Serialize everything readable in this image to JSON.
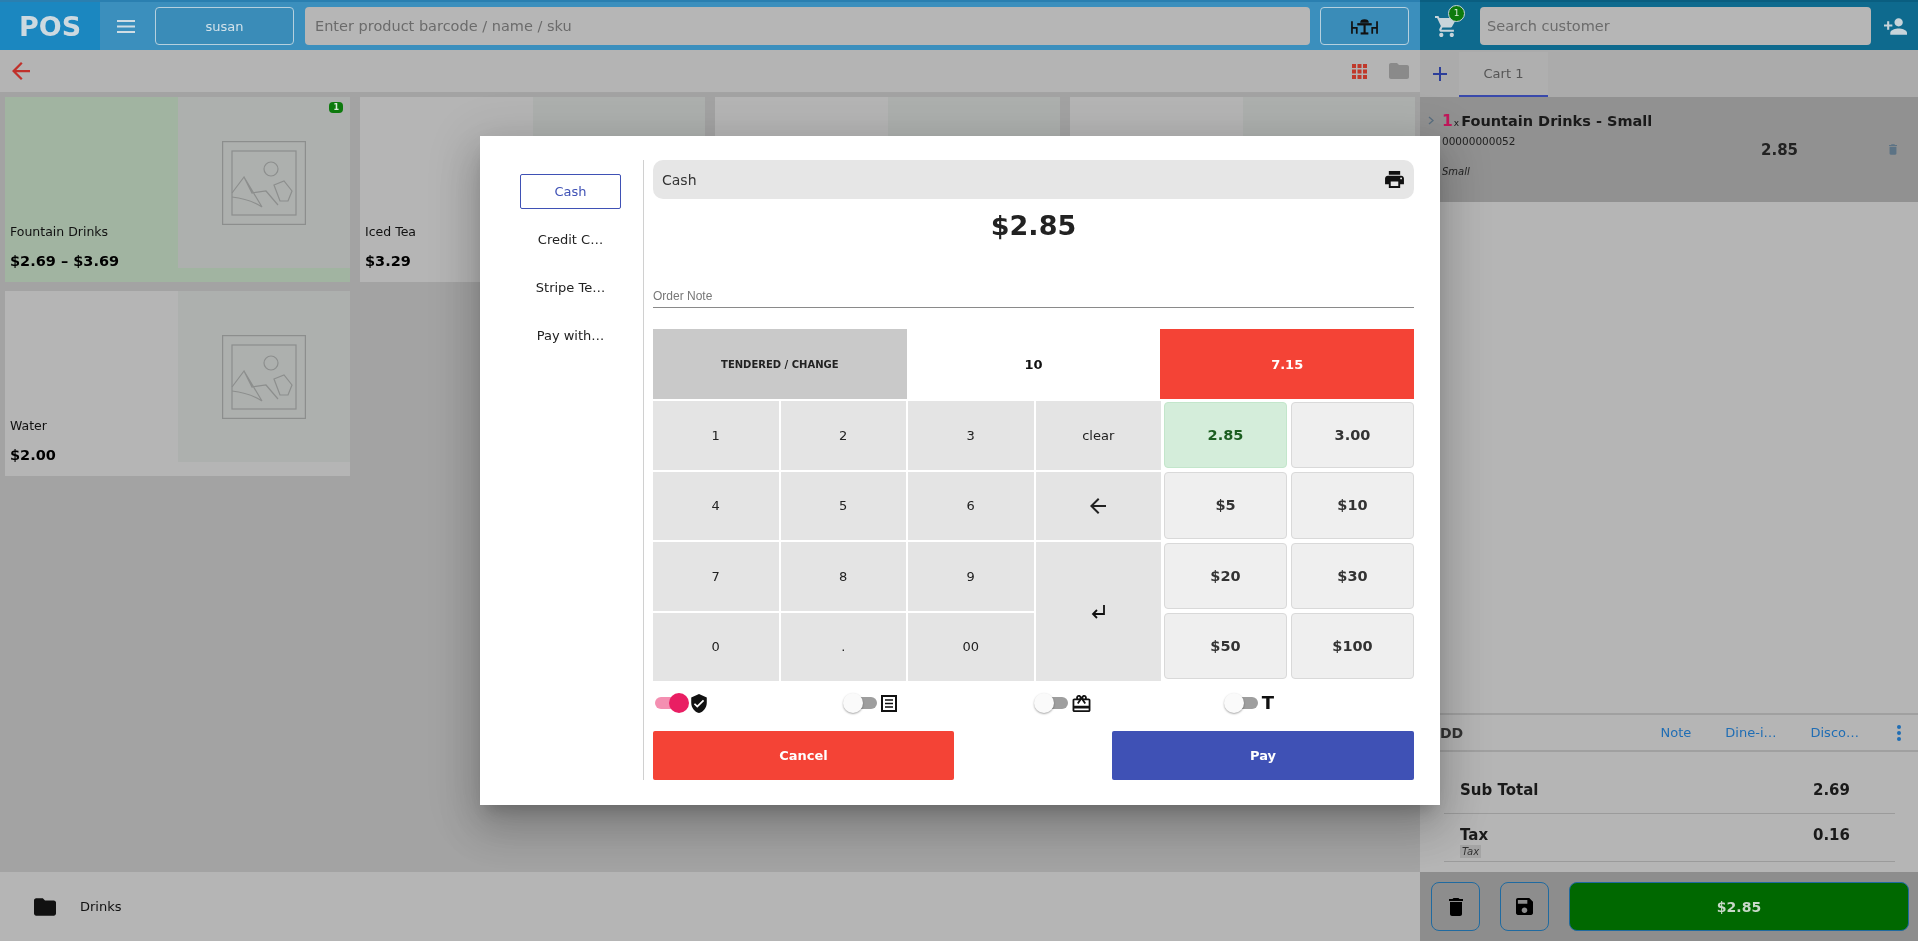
{
  "top_bar": {
    "logo": "POS",
    "user_button": "susan",
    "product_search": {
      "placeholder": "Enter product barcode / name / sku"
    },
    "cart_count": "1",
    "customer_search": {
      "placeholder": "Search customer"
    }
  },
  "view_modes": [
    {
      "kind": "grid",
      "selected": true
    },
    {
      "kind": "folder",
      "selected": false
    }
  ],
  "products": [
    {
      "kind": "full",
      "name": "Fountain Drinks",
      "price": "$2.69 – $3.69",
      "badge": "1",
      "selected": true
    },
    {
      "kind": "text",
      "name": "Iced Tea",
      "price": "$3.29",
      "selected": false
    },
    {
      "kind": "blank",
      "selected": false
    },
    {
      "kind": "blank",
      "selected": false
    },
    {
      "kind": "full",
      "name": "Water",
      "price": "$2.00",
      "selected": false
    }
  ],
  "categories": [
    {
      "name": "Drinks"
    }
  ],
  "cart": {
    "tabs": [
      {
        "label": "Cart 1",
        "selected": true
      }
    ],
    "items": [
      {
        "quantity": "1",
        "times": "x",
        "name": "Fountain Drinks - Small",
        "sku": "00000000052",
        "price": "2.85",
        "variant": "Small",
        "selected": true
      }
    ],
    "add_label": "DD",
    "links": [
      "Note",
      "Dine-i…",
      "Disco…"
    ],
    "totals": [
      {
        "label": "Sub Total",
        "value": "2.69"
      },
      {
        "label": "Tax",
        "value": "0.16",
        "note": "Tax"
      }
    ],
    "checkout_button": "$2.85"
  },
  "payment_dialog": {
    "methods": [
      {
        "label": "Cash",
        "selected": true
      },
      {
        "label": "Credit C…",
        "selected": false
      },
      {
        "label": "Stripe Te…",
        "selected": false
      },
      {
        "label": "Pay with…",
        "selected": false
      }
    ],
    "method_title": "Cash",
    "amount": "$2.85",
    "order_note": {
      "placeholder": "Order Note"
    },
    "tendered": {
      "label": "TENDERED / CHANGE",
      "tendered": "10",
      "change": "7.15"
    },
    "keys": [
      {
        "kind": "text",
        "label": "1"
      },
      {
        "kind": "text",
        "label": "2"
      },
      {
        "kind": "text",
        "label": "3"
      },
      {
        "kind": "text",
        "label": "clear"
      },
      {
        "kind": "text",
        "label": "4"
      },
      {
        "kind": "text",
        "label": "5"
      },
      {
        "kind": "text",
        "label": "6"
      },
      {
        "kind": "backspace"
      },
      {
        "kind": "text",
        "label": "7"
      },
      {
        "kind": "text",
        "label": "8"
      },
      {
        "kind": "text",
        "label": "9"
      },
      {
        "kind": "enter"
      },
      {
        "kind": "text",
        "label": "0"
      },
      {
        "kind": "text",
        "label": "."
      },
      {
        "kind": "text",
        "label": "00"
      }
    ],
    "quick_amounts": [
      {
        "label": "2.85",
        "selected": true
      },
      {
        "label": "3.00",
        "selected": false
      },
      {
        "label": "$5",
        "selected": false
      },
      {
        "label": "$10",
        "selected": false
      },
      {
        "label": "$20",
        "selected": false
      },
      {
        "label": "$30",
        "selected": false
      },
      {
        "label": "$50",
        "selected": false
      },
      {
        "label": "$100",
        "selected": false
      }
    ],
    "toggles": [
      {
        "kind": "shield",
        "on": true
      },
      {
        "kind": "receipt",
        "on": false
      },
      {
        "kind": "gift",
        "on": false
      },
      {
        "kind": "text",
        "label": "T",
        "on": false
      }
    ],
    "cancel_button": "Cancel",
    "pay_button": "Pay"
  }
}
